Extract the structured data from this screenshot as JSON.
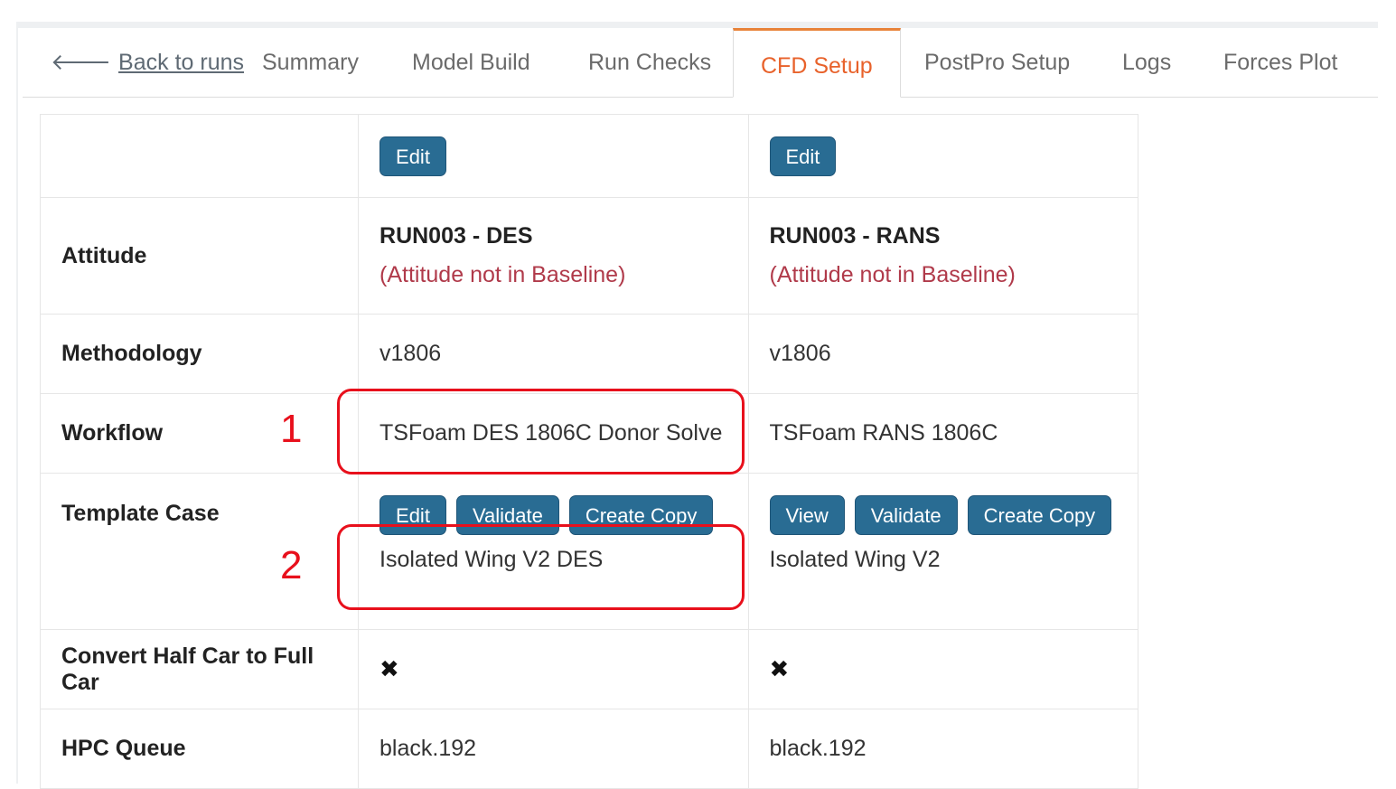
{
  "tabs": {
    "back": "Back to runs",
    "items": [
      "Summary",
      "Model Build",
      "Run Checks",
      "CFD Setup",
      "PostPro Setup",
      "Logs",
      "Forces Plot"
    ],
    "active": "CFD Setup"
  },
  "columns": [
    {
      "edit_label": "Edit",
      "attitude": "RUN003 - DES",
      "attitude_note": "(Attitude not in Baseline)",
      "methodology": "v1806",
      "workflow": "TSFoam DES 1806C Donor Solve",
      "template_buttons": [
        "Edit",
        "Validate",
        "Create Copy"
      ],
      "template_case": "Isolated Wing V2 DES",
      "convert_half_car": "✖",
      "hpc_queue": "black.192"
    },
    {
      "edit_label": "Edit",
      "attitude": "RUN003 - RANS",
      "attitude_note": "(Attitude not in Baseline)",
      "methodology": "v1806",
      "workflow": "TSFoam RANS 1806C",
      "template_buttons": [
        "View",
        "Validate",
        "Create Copy"
      ],
      "template_case": "Isolated Wing V2",
      "convert_half_car": "✖",
      "hpc_queue": "black.192"
    }
  ],
  "labels": {
    "attitude": "Attitude",
    "methodology": "Methodology",
    "workflow": "Workflow",
    "template_case": "Template Case",
    "convert": "Convert Half Car to Full Car",
    "hpc_queue": "HPC Queue"
  },
  "annotations": [
    "1",
    "2"
  ],
  "colors": {
    "accent": "#e8622b",
    "button": "#296c93",
    "warning": "#b03a4a",
    "annotation": "#e8101c"
  },
  "icons": {
    "back": "arrow-left-icon",
    "cross": "cross-icon"
  }
}
